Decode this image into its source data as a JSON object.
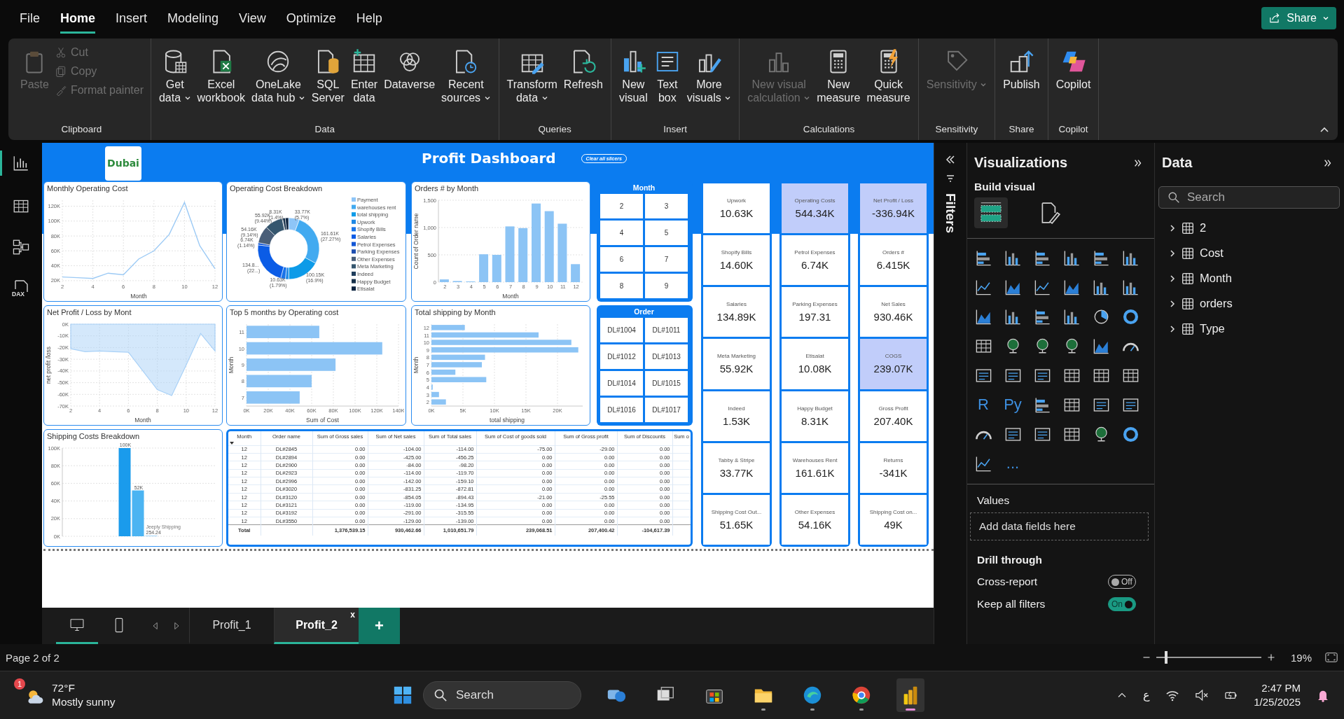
{
  "menu": {
    "tabs": [
      {
        "label": "File",
        "selected": false
      },
      {
        "label": "Home",
        "selected": true
      },
      {
        "label": "Insert",
        "selected": false
      },
      {
        "label": "Modeling",
        "selected": false
      },
      {
        "label": "View",
        "selected": false
      },
      {
        "label": "Optimize",
        "selected": false
      },
      {
        "label": "Help",
        "selected": false
      }
    ],
    "share": "Share"
  },
  "ribbon": {
    "groups": [
      {
        "label": "Clipboard",
        "buttons": [
          {
            "kind": "large",
            "lines": [
              "Paste"
            ],
            "disabled": true,
            "menu": false
          },
          {
            "kind": "small",
            "lines": [
              "Cut"
            ],
            "disabled": true,
            "menu": false
          },
          {
            "kind": "small",
            "lines": [
              "Copy"
            ],
            "disabled": true,
            "menu": false
          },
          {
            "kind": "small",
            "lines": [
              "Format painter"
            ],
            "disabled": true,
            "menu": false
          }
        ]
      },
      {
        "label": "Data",
        "buttons": [
          {
            "kind": "large",
            "lines": [
              "Get",
              "data"
            ],
            "disabled": false,
            "menu": true
          },
          {
            "kind": "large",
            "lines": [
              "Excel",
              "workbook"
            ],
            "disabled": false,
            "menu": false
          },
          {
            "kind": "large",
            "lines": [
              "OneLake",
              "data hub"
            ],
            "disabled": false,
            "menu": true
          },
          {
            "kind": "large",
            "lines": [
              "SQL",
              "Server"
            ],
            "disabled": false,
            "menu": false
          },
          {
            "kind": "large",
            "lines": [
              "Enter",
              "data"
            ],
            "disabled": false,
            "menu": false
          },
          {
            "kind": "large",
            "lines": [
              "Dataverse"
            ],
            "disabled": false,
            "menu": false
          },
          {
            "kind": "large",
            "lines": [
              "Recent",
              "sources"
            ],
            "disabled": false,
            "menu": true
          }
        ]
      },
      {
        "label": "Queries",
        "buttons": [
          {
            "kind": "large",
            "lines": [
              "Transform",
              "data"
            ],
            "disabled": false,
            "menu": true
          },
          {
            "kind": "large",
            "lines": [
              "Refresh"
            ],
            "disabled": false,
            "menu": false
          }
        ]
      },
      {
        "label": "Insert",
        "buttons": [
          {
            "kind": "large",
            "lines": [
              "New",
              "visual"
            ],
            "disabled": false,
            "menu": false
          },
          {
            "kind": "large",
            "lines": [
              "Text",
              "box"
            ],
            "disabled": false,
            "menu": false
          },
          {
            "kind": "large",
            "lines": [
              "More",
              "visuals"
            ],
            "disabled": false,
            "menu": true
          }
        ]
      },
      {
        "label": "Calculations",
        "buttons": [
          {
            "kind": "large",
            "lines": [
              "New visual",
              "calculation"
            ],
            "disabled": true,
            "menu": true
          },
          {
            "kind": "large",
            "lines": [
              "New",
              "measure"
            ],
            "disabled": false,
            "menu": false
          },
          {
            "kind": "large",
            "lines": [
              "Quick",
              "measure"
            ],
            "disabled": false,
            "menu": false
          }
        ]
      },
      {
        "label": "Sensitivity",
        "buttons": [
          {
            "kind": "large",
            "lines": [
              "Sensitivity"
            ],
            "disabled": true,
            "menu": true
          }
        ]
      },
      {
        "label": "Share",
        "buttons": [
          {
            "kind": "large",
            "lines": [
              "Publish"
            ],
            "disabled": false,
            "menu": false
          }
        ]
      },
      {
        "label": "Copilot",
        "buttons": [
          {
            "kind": "large",
            "lines": [
              "Copilot"
            ],
            "disabled": false,
            "menu": false
          }
        ]
      }
    ]
  },
  "rail": [
    {
      "selected": true
    },
    {
      "selected": false
    },
    {
      "selected": false
    },
    {
      "selected": false,
      "label": "DAX"
    }
  ],
  "report": {
    "logo": "Dubai",
    "title": "Profit Dashboard",
    "clear_button": "Clear all slicers",
    "charts": [
      {
        "chart_data": {
          "type": "line",
          "grid": true,
          "title": "Monthly Operating Cost",
          "xlabel": "Month",
          "x": [
            2,
            3,
            4,
            5,
            6,
            7,
            8,
            9,
            10,
            11,
            12
          ],
          "series": [
            {
              "color": "#9ccaf5",
              "values": [
                25000,
                24000,
                23000,
                30000,
                28000,
                49000,
                60000,
                82000,
                125000,
                67000,
                36000
              ]
            }
          ],
          "xlim": [
            2,
            12
          ],
          "ylim": [
            18000,
            128000
          ],
          "xticks": [
            2,
            4,
            6,
            8,
            10,
            12
          ],
          "yticks": [
            {
              "value": 20000,
              "label": "20K"
            },
            {
              "value": 40000,
              "label": "40K"
            },
            {
              "value": 60000,
              "label": "60K"
            },
            {
              "value": 80000,
              "label": "80K"
            },
            {
              "value": 100000,
              "label": "100K"
            },
            {
              "value": 120000,
              "label": "120K"
            }
          ]
        }
      },
      {
        "chart_data": {
          "type": "donut",
          "legend": "right",
          "title": "Operating Cost Breakdown",
          "categories": [
            "Payment",
            "warehouses rent",
            "total shipping",
            "Upwork",
            "Shopify Bills",
            "Salaries",
            "Petrol Expenses",
            "Parking Expenses",
            "Other Expenses",
            "Meta Marketing",
            "Indeed",
            "Happy Budget",
            "Etisalat"
          ],
          "colors": [
            "#8ec5f7",
            "#42aaf0",
            "#0d9be8",
            "#1e88e5",
            "#1a73e8",
            "#0b5ce6",
            "#1256d6",
            "#1f4fb0",
            "#495e78",
            "#35566e",
            "#1e3d5c",
            "#16304a",
            "#0d2440"
          ],
          "series": [
            {
              "values": [
                5.7,
                27.27,
                16.9,
                1.79,
                2.46,
                22.76,
                1.14,
                null,
                9.14,
                9.44,
                0.26,
                1.4,
                1.71
              ]
            }
          ],
          "value_labels": [
            "33.77K (5.7%)",
            "161.61K (27.27%)",
            "100.15K (16.9%)",
            "10.63K (1.79%)",
            null,
            "134.8... (22...)",
            "6.74K (1.14%)",
            null,
            "54.16K (9.14%)",
            "55.92K (9.44%)",
            null,
            "8.31K (1.4%)",
            null
          ]
        }
      },
      {
        "chart_data": {
          "type": "bar",
          "grid": true,
          "title": "Orders # by Month",
          "xlabel": "Month",
          "ylabel": "Count of Order name",
          "categories": [
            "2",
            "3",
            "4",
            "5",
            "6",
            "7",
            "8",
            "9",
            "10",
            "11",
            "12"
          ],
          "series": [
            {
              "color": "#8cc4f5",
              "values": [
                50,
                20,
                10,
                510,
                500,
                1020,
                990,
                1440,
                1300,
                1070,
                330
              ]
            }
          ],
          "ylim": [
            0,
            1500
          ],
          "yticks": [
            0,
            500,
            {
              "value": 1000,
              "label": "1,000"
            },
            {
              "value": 1500,
              "label": "1,500"
            }
          ]
        }
      },
      {
        "chart_data": {
          "type": "area",
          "grid": true,
          "title": "Net Profit / Loss by Mont",
          "xlabel": "Month",
          "ylabel": "net profit /loss",
          "x": [
            2,
            3,
            4,
            5,
            6,
            7,
            8,
            9,
            10,
            11,
            12
          ],
          "series": [
            {
              "color": "#a9d1f7",
              "values": [
                -21000,
                -23500,
                -23000,
                -23500,
                -24000,
                -40000,
                -56000,
                -61000,
                -35000,
                -8000,
                -23000
              ]
            }
          ],
          "xlim": [
            2,
            12
          ],
          "ylim": [
            -70000,
            0
          ],
          "xticks": [
            2,
            4,
            6,
            8,
            10,
            12
          ],
          "yticks": [
            {
              "value": 0,
              "label": "0K"
            },
            {
              "value": -10000,
              "label": "-10K"
            },
            {
              "value": -20000,
              "label": "-20K"
            },
            {
              "value": -30000,
              "label": "-30K"
            },
            {
              "value": -40000,
              "label": "-40K"
            },
            {
              "value": -50000,
              "label": "-50K"
            },
            {
              "value": -60000,
              "label": "-60K"
            },
            {
              "value": -70000,
              "label": "-70K"
            }
          ]
        }
      },
      {
        "chart_data": {
          "type": "bar",
          "grid": true,
          "orientation": "horizontal",
          "title": "Top 5 months by Operating cost",
          "xlabel": "Sum of Cost",
          "ylabel": "Month",
          "categories": [
            "11",
            "10",
            "9",
            "8",
            "7"
          ],
          "series": [
            {
              "color": "#8cc4f5",
              "values": [
                67000,
                125000,
                82000,
                60000,
                49000
              ]
            }
          ],
          "xlim": [
            0,
            140000
          ],
          "xticks": [
            {
              "value": 0,
              "label": "0K"
            },
            {
              "value": 20000,
              "label": "20K"
            },
            {
              "value": 40000,
              "label": "40K"
            },
            {
              "value": 60000,
              "label": "60K"
            },
            {
              "value": 80000,
              "label": "80K"
            },
            {
              "value": 100000,
              "label": "100K"
            },
            {
              "value": 120000,
              "label": "120K"
            },
            {
              "value": 140000,
              "label": "140K"
            }
          ]
        }
      },
      {
        "chart_data": {
          "type": "bar",
          "grid": true,
          "orientation": "horizontal",
          "title": "Total shipping by Month",
          "xlabel": "total shipping",
          "ylabel": "Month",
          "categories": [
            "12",
            "11",
            "10",
            "9",
            "8",
            "7",
            "6",
            "5",
            "4",
            "3",
            "2"
          ],
          "series": [
            {
              "color": "#8cc4f5",
              "values": [
                5300,
                17000,
                22200,
                23300,
                8500,
                8000,
                3800,
                8700,
                200,
                1200,
                2300
              ]
            }
          ],
          "xlim": [
            0,
            24000
          ],
          "xticks": [
            {
              "value": 0,
              "label": "0K"
            },
            {
              "value": 5000,
              "label": "5K"
            },
            {
              "value": 10000,
              "label": "10K"
            },
            {
              "value": 15000,
              "label": "15K"
            },
            {
              "value": 20000,
              "label": "20K"
            }
          ]
        }
      },
      {
        "chart_data": {
          "type": "bar",
          "grid": true,
          "title": "Shipping Costs Breakdown",
          "series": [
            {
              "color": "#1a9bec",
              "values": [
                100000
              ]
            },
            {
              "color": "#4bb4f2",
              "values": [
                52000
              ]
            },
            {
              "name": "Jeeply Shipping",
              "color": "#9fd3f7",
              "values": [
                254.24
              ]
            }
          ],
          "ylim": [
            0,
            100000
          ],
          "yticks": [
            {
              "value": 0,
              "label": "0K"
            },
            {
              "value": 20000,
              "label": "20K"
            },
            {
              "value": 40000,
              "label": "40K"
            },
            {
              "value": 60000,
              "label": "60K"
            },
            {
              "value": 80000,
              "label": "80K"
            },
            {
              "value": 100000,
              "label": "100K"
            }
          ],
          "value_labels": [
            "100K",
            "52K",
            "254.24"
          ]
        }
      }
    ],
    "slicers": [
      {
        "title": "Month",
        "items": [
          {
            "label": "2",
            "selected": false
          },
          {
            "label": "3",
            "selected": false
          },
          {
            "label": "4",
            "selected": false
          },
          {
            "label": "5",
            "selected": false
          },
          {
            "label": "6",
            "selected": false
          },
          {
            "label": "7",
            "selected": false
          },
          {
            "label": "8",
            "selected": false
          },
          {
            "label": "9",
            "selected": false
          }
        ]
      },
      {
        "title": "Order",
        "items": [
          {
            "label": "DL#1004",
            "selected": false
          },
          {
            "label": "DL#1011",
            "selected": false
          },
          {
            "label": "DL#1012",
            "selected": false
          },
          {
            "label": "DL#1013",
            "selected": false
          },
          {
            "label": "DL#1014",
            "selected": false
          },
          {
            "label": "DL#1015",
            "selected": false
          },
          {
            "label": "DL#1016",
            "selected": false
          },
          {
            "label": "DL#1017",
            "selected": false
          }
        ]
      }
    ],
    "table": {
      "columns": [
        {
          "label": "Month",
          "sorted": true
        },
        {
          "label": "Order name",
          "sorted": false
        },
        {
          "label": "Sum of Gross sales",
          "sorted": false
        },
        {
          "label": "Sum of Net sales",
          "sorted": false
        },
        {
          "label": "Sum of Total sales",
          "sorted": false
        },
        {
          "label": "Sum of Cost of goods sold",
          "sorted": false
        },
        {
          "label": "Sum of Gross profit",
          "sorted": false
        },
        {
          "label": "Sum of Discounts",
          "sorted": false
        },
        {
          "label": "Sum o",
          "sorted": false
        }
      ],
      "rows": [
        [
          "12",
          "DL#2845",
          "0.00",
          "-104.00",
          "-114.00",
          "-75.00",
          "-29.00",
          "0.00"
        ],
        [
          "12",
          "DL#2894",
          "0.00",
          "-425.00",
          "-456.25",
          "0.00",
          "0.00",
          "0.00"
        ],
        [
          "12",
          "DL#2900",
          "0.00",
          "-84.00",
          "-98.20",
          "0.00",
          "0.00",
          "0.00"
        ],
        [
          "12",
          "DL#2923",
          "0.00",
          "-114.00",
          "-119.70",
          "0.00",
          "0.00",
          "0.00"
        ],
        [
          "12",
          "DL#2996",
          "0.00",
          "-142.00",
          "-159.10",
          "0.00",
          "0.00",
          "0.00"
        ],
        [
          "12",
          "DL#3020",
          "0.00",
          "-831.25",
          "-872.81",
          "0.00",
          "0.00",
          "0.00"
        ],
        [
          "12",
          "DL#3120",
          "0.00",
          "-854.05",
          "-894.43",
          "-21.00",
          "-25.55",
          "0.00"
        ],
        [
          "12",
          "DL#3121",
          "0.00",
          "-119.00",
          "-134.95",
          "0.00",
          "0.00",
          "0.00"
        ],
        [
          "12",
          "DL#3192",
          "0.00",
          "-291.00",
          "-315.55",
          "0.00",
          "0.00",
          "0.00"
        ],
        [
          "12",
          "DL#3550",
          "0.00",
          "-129.00",
          "-139.00",
          "0.00",
          "0.00",
          "0.00"
        ]
      ],
      "total": {
        "label": "Total",
        "cells": [
          "1,376,539.15",
          "930,462.66",
          "1,010,651.79",
          "239,068.51",
          "207,400.42",
          "-104,617.39"
        ]
      }
    },
    "card_columns": [
      {
        "cards": [
          {
            "label": "Upwork",
            "value": "10.63K",
            "highlighted": false
          },
          {
            "label": "Shopify Bills",
            "value": "14.60K",
            "highlighted": false
          },
          {
            "label": "Salaries",
            "value": "134.89K",
            "highlighted": false
          },
          {
            "label": "Meta Marketing",
            "value": "55.92K",
            "highlighted": false
          },
          {
            "label": "Indeed",
            "value": "1.53K",
            "highlighted": false
          },
          {
            "label": "Tabby & Stripe",
            "value": "33.77K",
            "highlighted": false
          },
          {
            "label": "Shipping Cost Out...",
            "value": "51.65K",
            "highlighted": false
          }
        ]
      },
      {
        "cards": [
          {
            "label": "Operating Costs",
            "value": "544.34K",
            "highlighted": true
          },
          {
            "label": "Petrol Expenses",
            "value": "6.74K",
            "highlighted": false
          },
          {
            "label": "Parking Expenses",
            "value": "197.31",
            "highlighted": false
          },
          {
            "label": "Etisalat",
            "value": "10.08K",
            "highlighted": false
          },
          {
            "label": "Happy Budget",
            "value": "8.31K",
            "highlighted": false
          },
          {
            "label": "Warehouses Rent",
            "value": "161.61K",
            "highlighted": false
          },
          {
            "label": "Other Expenses",
            "value": "54.16K",
            "highlighted": false
          }
        ]
      },
      {
        "cards": [
          {
            "label": "Net Profit / Loss",
            "value": "-336.94K",
            "highlighted": true
          },
          {
            "label": "Orders #",
            "value": "6.415K",
            "highlighted": false
          },
          {
            "label": "Net Sales",
            "value": "930.46K",
            "highlighted": false
          },
          {
            "label": "COGS",
            "value": "239.07K",
            "highlighted": true
          },
          {
            "label": "Gross Profit",
            "value": "207.40K",
            "highlighted": false
          },
          {
            "label": "Returns",
            "value": "-341K",
            "highlighted": false
          },
          {
            "label": "Shipping Cost on...",
            "value": "49K",
            "highlighted": false
          }
        ]
      }
    ]
  },
  "filters": {
    "label": "Filters"
  },
  "visualizations": {
    "title": "Visualizations",
    "subtitle": "Build visual",
    "tabs": [
      {
        "selected": true
      },
      {
        "selected": false
      }
    ],
    "gallery": [
      {
        "kind": "icon"
      },
      {
        "kind": "icon"
      },
      {
        "kind": "icon"
      },
      {
        "kind": "icon"
      },
      {
        "kind": "icon"
      },
      {
        "kind": "icon"
      },
      {
        "kind": "icon"
      },
      {
        "kind": "icon"
      },
      {
        "kind": "icon"
      },
      {
        "kind": "icon"
      },
      {
        "kind": "icon"
      },
      {
        "kind": "icon"
      },
      {
        "kind": "icon"
      },
      {
        "kind": "icon"
      },
      {
        "kind": "icon"
      },
      {
        "kind": "icon"
      },
      {
        "kind": "icon"
      },
      {
        "kind": "icon"
      },
      {
        "kind": "icon"
      },
      {
        "kind": "icon"
      },
      {
        "kind": "icon"
      },
      {
        "kind": "icon"
      },
      {
        "kind": "icon"
      },
      {
        "kind": "icon"
      },
      {
        "kind": "icon"
      },
      {
        "kind": "icon"
      },
      {
        "kind": "icon"
      },
      {
        "kind": "icon"
      },
      {
        "kind": "icon"
      },
      {
        "kind": "icon"
      },
      {
        "kind": "text",
        "label": "R"
      },
      {
        "kind": "text",
        "label": "Py"
      },
      {
        "kind": "icon"
      },
      {
        "kind": "icon"
      },
      {
        "kind": "icon"
      },
      {
        "kind": "icon"
      },
      {
        "kind": "icon"
      },
      {
        "kind": "icon"
      },
      {
        "kind": "icon"
      },
      {
        "kind": "icon"
      },
      {
        "kind": "icon"
      },
      {
        "kind": "icon"
      },
      {
        "kind": "icon"
      },
      {
        "kind": "text",
        "label": "..."
      }
    ],
    "values_label": "Values",
    "values_placeholder": "Add data fields here",
    "drill_title": "Drill through",
    "toggles": [
      {
        "label": "Cross-report",
        "on": false,
        "text": "Off"
      },
      {
        "label": "Keep all filters",
        "on": true,
        "text": "On"
      }
    ]
  },
  "data_pane": {
    "title": "Data",
    "search_placeholder": "Search",
    "tables": [
      {
        "label": "2",
        "expanded": false
      },
      {
        "label": "Cost",
        "expanded": false
      },
      {
        "label": "Month",
        "expanded": false
      },
      {
        "label": "orders",
        "expanded": false
      },
      {
        "label": "Type",
        "expanded": false
      }
    ]
  },
  "page_tabs": {
    "views": [
      {
        "selected": true
      },
      {
        "selected": false
      }
    ],
    "tabs": [
      {
        "label": "Profit_1",
        "selected": false
      },
      {
        "label": "Profit_2",
        "selected": true,
        "close": "x"
      }
    ],
    "add": "+"
  },
  "status": {
    "page": "Page 2 of 2",
    "zoom_slider": {
      "level": 0.08
    },
    "zoom": "19%"
  },
  "taskbar": {
    "weather": {
      "badge": "1",
      "temp": "72°F",
      "text": "Mostly sunny"
    },
    "search": "Search",
    "apps": [
      {
        "running": false,
        "active": false
      },
      {
        "running": false,
        "active": false
      },
      {
        "running": false,
        "active": false
      },
      {
        "running": true,
        "active": false
      },
      {
        "running": true,
        "active": false
      },
      {
        "running": true,
        "active": false
      },
      {
        "running": true,
        "active": true
      }
    ],
    "language": "ع",
    "time": "2:47 PM",
    "date": "1/25/2025"
  }
}
